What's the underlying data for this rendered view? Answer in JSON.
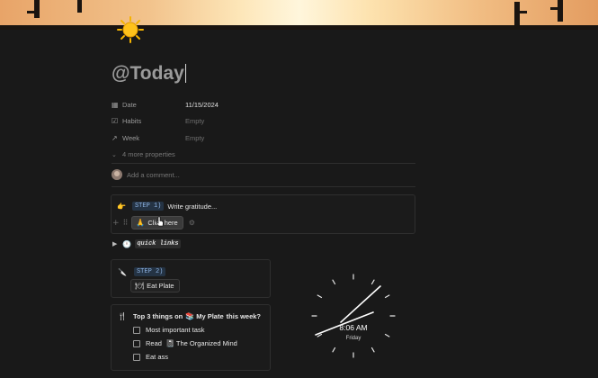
{
  "page": {
    "icon": "sun-emoji",
    "title": "@Today"
  },
  "properties": [
    {
      "icon": "calendar-icon",
      "glyph": "▦",
      "label": "Date",
      "value": "11/15/2024",
      "empty": false
    },
    {
      "icon": "checkbox-icon",
      "glyph": "☑",
      "label": "Habits",
      "value": "Empty",
      "empty": true
    },
    {
      "icon": "arrow-up-right-icon",
      "glyph": "↗",
      "label": "Week",
      "value": "Empty",
      "empty": true
    }
  ],
  "more_properties": "4 more properties",
  "comment_placeholder": "Add a comment...",
  "step1": {
    "emoji": "👉",
    "tag": "STEP 1)",
    "text": "Write gratitude...",
    "button_emoji": "🙏",
    "button_label": "Click here"
  },
  "quick_links": {
    "emoji": "🕛",
    "label": "quick links"
  },
  "step2": {
    "emoji": "🔪",
    "tag": "STEP 2)",
    "button_emoji": "🍽",
    "button_label": "Eat Plate"
  },
  "top3": {
    "emoji": "🍴",
    "heading_pre": "Top 3 things on",
    "heading_link": "My Plate",
    "heading_post": "this week?",
    "items": [
      {
        "label": "Most important task",
        "link": ""
      },
      {
        "label": "Read",
        "link": "The Organized Mind"
      },
      {
        "label": "Eat ass",
        "link": ""
      }
    ]
  },
  "clock": {
    "time": "8:06 AM",
    "day": "Friday",
    "hour": 8,
    "minute": 6
  },
  "colors": {
    "background": "#191919",
    "step_tag_bg": "#243344",
    "step_tag_fg": "#8fb4e3"
  }
}
